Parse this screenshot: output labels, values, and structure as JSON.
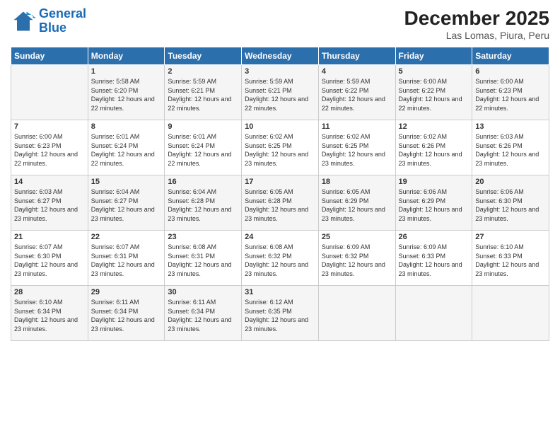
{
  "logo": {
    "line1": "General",
    "line2": "Blue"
  },
  "title": "December 2025",
  "subtitle": "Las Lomas, Piura, Peru",
  "days_of_week": [
    "Sunday",
    "Monday",
    "Tuesday",
    "Wednesday",
    "Thursday",
    "Friday",
    "Saturday"
  ],
  "weeks": [
    [
      {
        "num": "",
        "sunrise": "",
        "sunset": "",
        "daylight": ""
      },
      {
        "num": "1",
        "sunrise": "Sunrise: 5:58 AM",
        "sunset": "Sunset: 6:20 PM",
        "daylight": "Daylight: 12 hours and 22 minutes."
      },
      {
        "num": "2",
        "sunrise": "Sunrise: 5:59 AM",
        "sunset": "Sunset: 6:21 PM",
        "daylight": "Daylight: 12 hours and 22 minutes."
      },
      {
        "num": "3",
        "sunrise": "Sunrise: 5:59 AM",
        "sunset": "Sunset: 6:21 PM",
        "daylight": "Daylight: 12 hours and 22 minutes."
      },
      {
        "num": "4",
        "sunrise": "Sunrise: 5:59 AM",
        "sunset": "Sunset: 6:22 PM",
        "daylight": "Daylight: 12 hours and 22 minutes."
      },
      {
        "num": "5",
        "sunrise": "Sunrise: 6:00 AM",
        "sunset": "Sunset: 6:22 PM",
        "daylight": "Daylight: 12 hours and 22 minutes."
      },
      {
        "num": "6",
        "sunrise": "Sunrise: 6:00 AM",
        "sunset": "Sunset: 6:23 PM",
        "daylight": "Daylight: 12 hours and 22 minutes."
      }
    ],
    [
      {
        "num": "7",
        "sunrise": "Sunrise: 6:00 AM",
        "sunset": "Sunset: 6:23 PM",
        "daylight": "Daylight: 12 hours and 22 minutes."
      },
      {
        "num": "8",
        "sunrise": "Sunrise: 6:01 AM",
        "sunset": "Sunset: 6:24 PM",
        "daylight": "Daylight: 12 hours and 22 minutes."
      },
      {
        "num": "9",
        "sunrise": "Sunrise: 6:01 AM",
        "sunset": "Sunset: 6:24 PM",
        "daylight": "Daylight: 12 hours and 22 minutes."
      },
      {
        "num": "10",
        "sunrise": "Sunrise: 6:02 AM",
        "sunset": "Sunset: 6:25 PM",
        "daylight": "Daylight: 12 hours and 23 minutes."
      },
      {
        "num": "11",
        "sunrise": "Sunrise: 6:02 AM",
        "sunset": "Sunset: 6:25 PM",
        "daylight": "Daylight: 12 hours and 23 minutes."
      },
      {
        "num": "12",
        "sunrise": "Sunrise: 6:02 AM",
        "sunset": "Sunset: 6:26 PM",
        "daylight": "Daylight: 12 hours and 23 minutes."
      },
      {
        "num": "13",
        "sunrise": "Sunrise: 6:03 AM",
        "sunset": "Sunset: 6:26 PM",
        "daylight": "Daylight: 12 hours and 23 minutes."
      }
    ],
    [
      {
        "num": "14",
        "sunrise": "Sunrise: 6:03 AM",
        "sunset": "Sunset: 6:27 PM",
        "daylight": "Daylight: 12 hours and 23 minutes."
      },
      {
        "num": "15",
        "sunrise": "Sunrise: 6:04 AM",
        "sunset": "Sunset: 6:27 PM",
        "daylight": "Daylight: 12 hours and 23 minutes."
      },
      {
        "num": "16",
        "sunrise": "Sunrise: 6:04 AM",
        "sunset": "Sunset: 6:28 PM",
        "daylight": "Daylight: 12 hours and 23 minutes."
      },
      {
        "num": "17",
        "sunrise": "Sunrise: 6:05 AM",
        "sunset": "Sunset: 6:28 PM",
        "daylight": "Daylight: 12 hours and 23 minutes."
      },
      {
        "num": "18",
        "sunrise": "Sunrise: 6:05 AM",
        "sunset": "Sunset: 6:29 PM",
        "daylight": "Daylight: 12 hours and 23 minutes."
      },
      {
        "num": "19",
        "sunrise": "Sunrise: 6:06 AM",
        "sunset": "Sunset: 6:29 PM",
        "daylight": "Daylight: 12 hours and 23 minutes."
      },
      {
        "num": "20",
        "sunrise": "Sunrise: 6:06 AM",
        "sunset": "Sunset: 6:30 PM",
        "daylight": "Daylight: 12 hours and 23 minutes."
      }
    ],
    [
      {
        "num": "21",
        "sunrise": "Sunrise: 6:07 AM",
        "sunset": "Sunset: 6:30 PM",
        "daylight": "Daylight: 12 hours and 23 minutes."
      },
      {
        "num": "22",
        "sunrise": "Sunrise: 6:07 AM",
        "sunset": "Sunset: 6:31 PM",
        "daylight": "Daylight: 12 hours and 23 minutes."
      },
      {
        "num": "23",
        "sunrise": "Sunrise: 6:08 AM",
        "sunset": "Sunset: 6:31 PM",
        "daylight": "Daylight: 12 hours and 23 minutes."
      },
      {
        "num": "24",
        "sunrise": "Sunrise: 6:08 AM",
        "sunset": "Sunset: 6:32 PM",
        "daylight": "Daylight: 12 hours and 23 minutes."
      },
      {
        "num": "25",
        "sunrise": "Sunrise: 6:09 AM",
        "sunset": "Sunset: 6:32 PM",
        "daylight": "Daylight: 12 hours and 23 minutes."
      },
      {
        "num": "26",
        "sunrise": "Sunrise: 6:09 AM",
        "sunset": "Sunset: 6:33 PM",
        "daylight": "Daylight: 12 hours and 23 minutes."
      },
      {
        "num": "27",
        "sunrise": "Sunrise: 6:10 AM",
        "sunset": "Sunset: 6:33 PM",
        "daylight": "Daylight: 12 hours and 23 minutes."
      }
    ],
    [
      {
        "num": "28",
        "sunrise": "Sunrise: 6:10 AM",
        "sunset": "Sunset: 6:34 PM",
        "daylight": "Daylight: 12 hours and 23 minutes."
      },
      {
        "num": "29",
        "sunrise": "Sunrise: 6:11 AM",
        "sunset": "Sunset: 6:34 PM",
        "daylight": "Daylight: 12 hours and 23 minutes."
      },
      {
        "num": "30",
        "sunrise": "Sunrise: 6:11 AM",
        "sunset": "Sunset: 6:34 PM",
        "daylight": "Daylight: 12 hours and 23 minutes."
      },
      {
        "num": "31",
        "sunrise": "Sunrise: 6:12 AM",
        "sunset": "Sunset: 6:35 PM",
        "daylight": "Daylight: 12 hours and 23 minutes."
      },
      {
        "num": "",
        "sunrise": "",
        "sunset": "",
        "daylight": ""
      },
      {
        "num": "",
        "sunrise": "",
        "sunset": "",
        "daylight": ""
      },
      {
        "num": "",
        "sunrise": "",
        "sunset": "",
        "daylight": ""
      }
    ]
  ]
}
